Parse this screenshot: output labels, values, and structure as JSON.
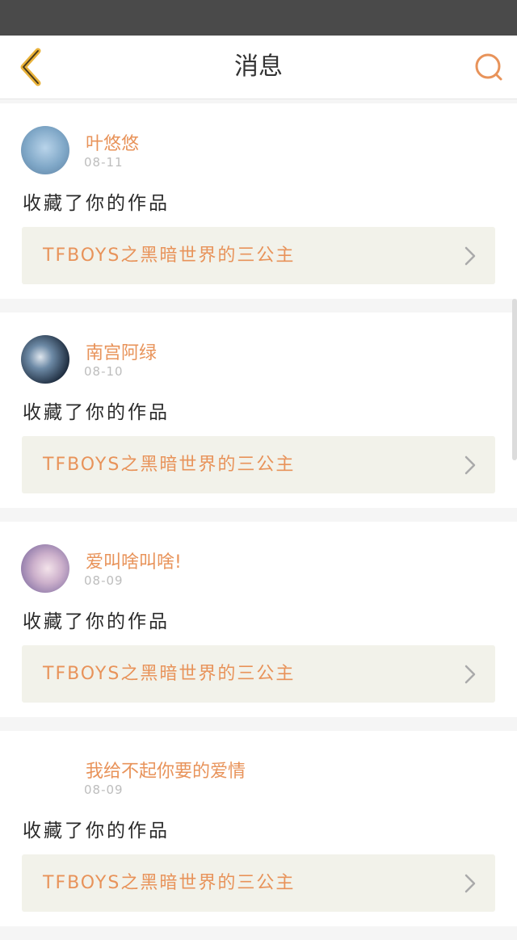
{
  "header": {
    "title": "消息",
    "back_icon": "chevron-left-icon",
    "search_icon": "search-icon"
  },
  "colors": {
    "accent": "#e8935a",
    "back": "#e9b23a",
    "link_bg": "#f2f2ea"
  },
  "messages": [
    {
      "username": "叶悠悠",
      "date": "08-11",
      "action": "收藏了你的作品",
      "work_title": "TFBOYS之黑暗世界的三公主"
    },
    {
      "username": "南宫阿绿",
      "date": "08-10",
      "action": "收藏了你的作品",
      "work_title": "TFBOYS之黑暗世界的三公主"
    },
    {
      "username": "爱叫啥叫啥!",
      "date": "08-09",
      "action": "收藏了你的作品",
      "work_title": "TFBOYS之黑暗世界的三公主"
    },
    {
      "username": "我给不起你要的爱情",
      "date": "08-09",
      "action": "收藏了你的作品",
      "work_title": "TFBOYS之黑暗世界的三公主"
    }
  ]
}
